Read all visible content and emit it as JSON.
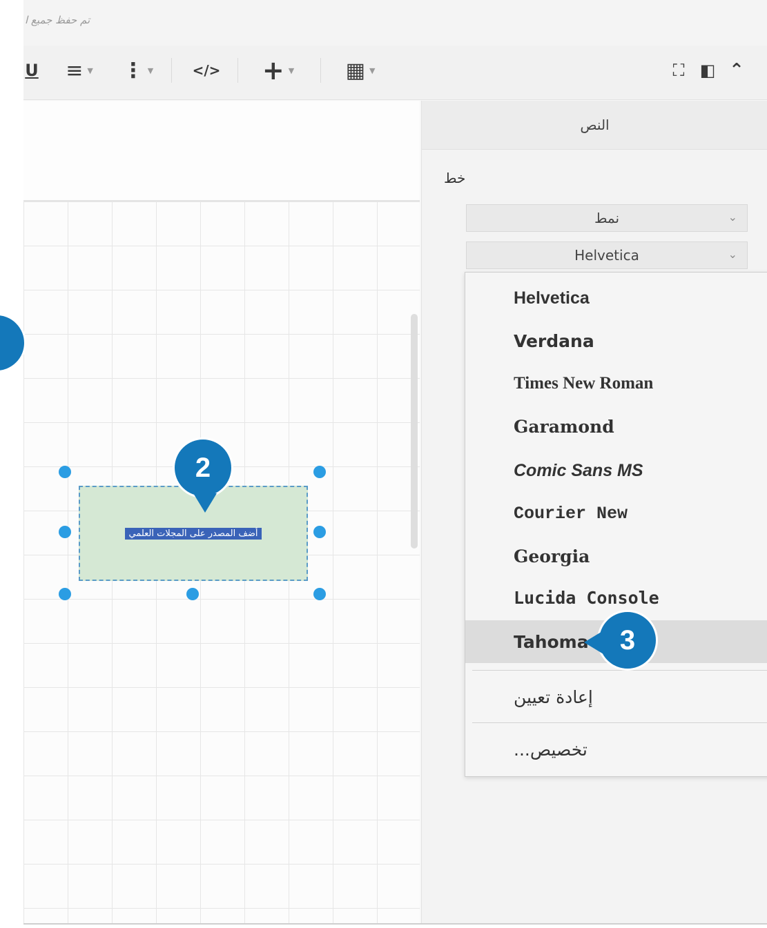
{
  "status": {
    "text": "تم حفظ جميع ا"
  },
  "toolbar": {
    "underline": "U",
    "align": "≡",
    "spacing": "⋮",
    "html": "</>",
    "insert": "+",
    "table": "▦",
    "fullscreen": "⛶",
    "format_panel": "◧",
    "collapse": "⌃"
  },
  "panel": {
    "tab_label": "النص",
    "section_label": "خط",
    "style_select": "نمط",
    "font_select": "Helvetica"
  },
  "font_menu": {
    "items": [
      "Helvetica",
      "Verdana",
      "Times New Roman",
      "Garamond",
      "Comic Sans MS",
      "Courier New",
      "Georgia",
      "Lucida Console",
      "Tahoma"
    ],
    "highlighted": "Tahoma",
    "reset": "إعادة تعيين",
    "custom": "تخصيص..."
  },
  "shape": {
    "label": "أضف المصدر على المجلات العلمي"
  },
  "callouts": {
    "two": "2",
    "three": "3"
  },
  "colors": {
    "callout": "#1478ba",
    "handle": "#2b9de3",
    "shape_fill": "#d5e8d4"
  }
}
